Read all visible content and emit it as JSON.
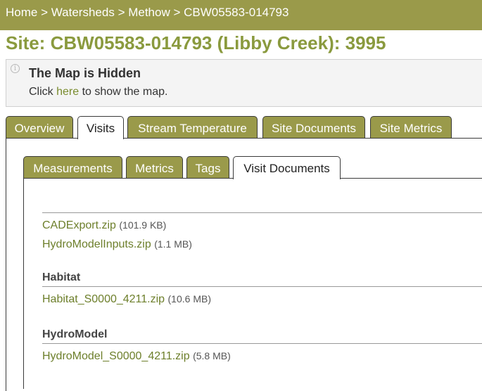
{
  "breadcrumb": {
    "items": [
      "Home",
      "Watersheds",
      "Methow",
      "CBW05583-014793"
    ],
    "separator": ">"
  },
  "site_title": "Site: CBW05583-014793 (Libby Creek): 3995",
  "map_notice": {
    "heading": "The Map is Hidden",
    "text_before": "Click ",
    "link": "here",
    "text_after": " to show the map."
  },
  "main_tabs": [
    "Overview",
    "Visits",
    "Stream Temperature",
    "Site Documents",
    "Site Metrics"
  ],
  "main_active_tab": "Visits",
  "sub_tabs": [
    "Measurements",
    "Metrics",
    "Tags",
    "Visit Documents"
  ],
  "sub_active_tab": "Visit Documents",
  "documents": [
    {
      "heading": "",
      "files": [
        {
          "name": "CADExport.zip",
          "size": "(101.9 KB)"
        },
        {
          "name": "HydroModelInputs.zip",
          "size": "(1.1 MB)"
        }
      ]
    },
    {
      "heading": "Habitat",
      "files": [
        {
          "name": "Habitat_S0000_4211.zip",
          "size": "(10.6 MB)"
        }
      ]
    },
    {
      "heading": "HydroModel",
      "files": [
        {
          "name": "HydroModel_S0000_4211.zip",
          "size": "(5.8 MB)"
        }
      ]
    }
  ],
  "colors": {
    "olive_bar": "#9a9a4a",
    "title_green": "#8a9a3e",
    "link_green": "#6d7f2b"
  }
}
